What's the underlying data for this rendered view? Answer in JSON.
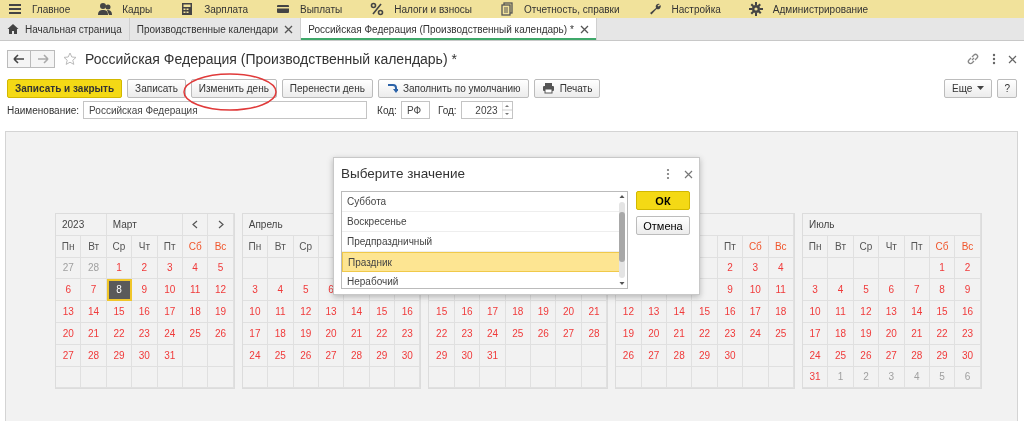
{
  "main_menu": [
    {
      "label": "Главное"
    },
    {
      "label": "Кадры"
    },
    {
      "label": "Зарплата"
    },
    {
      "label": "Выплаты"
    },
    {
      "label": "Налоги и взносы"
    },
    {
      "label": "Отчетность, справки"
    },
    {
      "label": "Настройка"
    },
    {
      "label": "Администрирование"
    }
  ],
  "tabs": [
    {
      "label": "Начальная страница",
      "selected": false,
      "closable": false
    },
    {
      "label": "Производственные календари",
      "selected": false,
      "closable": true
    },
    {
      "label": "Российская Федерация (Производственный календарь) *",
      "selected": true,
      "closable": true
    }
  ],
  "form": {
    "title": "Российская Федерация (Производственный календарь) *"
  },
  "toolbar": [
    {
      "label": "Записать и закрыть",
      "kind": "primary"
    },
    {
      "label": "Записать",
      "kind": "plain"
    },
    {
      "label": "Изменить день",
      "kind": "plain"
    },
    {
      "label": "Перенести день",
      "kind": "plain"
    },
    {
      "label": "Заполнить по умолчанию",
      "kind": "fill"
    },
    {
      "label": "Печать",
      "kind": "print"
    }
  ],
  "toolbar_right": [
    {
      "label": "Еще",
      "kind": "menu"
    },
    {
      "label": "?",
      "kind": "plain"
    }
  ],
  "fields": {
    "name_label": "Наименование:",
    "name_value": "Российская Федерация",
    "code_label": "Код:",
    "code_value": "РФ",
    "year_label": "Год:",
    "year_value": "2023"
  },
  "calendar": {
    "year": "2023",
    "months": [
      {
        "name": "Март",
        "weekdays": [
          {
            "kind": "label",
            "label": "Пн",
            "weekend": false
          },
          {
            "kind": "label",
            "label": "Вт",
            "weekend": false
          },
          {
            "kind": "label",
            "label": "Ср",
            "weekend": false
          },
          {
            "kind": "label",
            "label": "Чт",
            "weekend": false
          },
          {
            "kind": "label",
            "label": "Пт",
            "weekend": false
          },
          {
            "kind": "label",
            "label": "Сб",
            "weekend": true
          },
          {
            "kind": "label",
            "label": "Вс",
            "weekend": true
          }
        ],
        "weeks": [
          [
            {
              "kind": "day",
              "text": "27",
              "other_month": true,
              "selected": false
            },
            {
              "kind": "day",
              "text": "28",
              "other_month": true,
              "selected": false
            },
            {
              "kind": "day",
              "text": "1",
              "other_month": false,
              "selected": false
            },
            {
              "kind": "day",
              "text": "2",
              "other_month": false,
              "selected": false
            },
            {
              "kind": "day",
              "text": "3",
              "other_month": false,
              "selected": false
            },
            {
              "kind": "day",
              "text": "4",
              "other_month": false,
              "selected": false
            },
            {
              "kind": "day",
              "text": "5",
              "other_month": false,
              "selected": false
            }
          ],
          [
            {
              "kind": "day",
              "text": "6",
              "other_month": false,
              "selected": false
            },
            {
              "kind": "day",
              "text": "7",
              "other_month": false,
              "selected": false
            },
            {
              "kind": "day",
              "text": "8",
              "other_month": false,
              "selected": true
            },
            {
              "kind": "day",
              "text": "9",
              "other_month": false,
              "selected": false
            },
            {
              "kind": "day",
              "text": "10",
              "other_month": false,
              "selected": false
            },
            {
              "kind": "day",
              "text": "11",
              "other_month": false,
              "selected": false
            },
            {
              "kind": "day",
              "text": "12",
              "other_month": false,
              "selected": false
            }
          ],
          [
            {
              "kind": "day",
              "text": "13",
              "other_month": false,
              "selected": false
            },
            {
              "kind": "day",
              "text": "14",
              "other_month": false,
              "selected": false
            },
            {
              "kind": "day",
              "text": "15",
              "other_month": false,
              "selected": false
            },
            {
              "kind": "day",
              "text": "16",
              "other_month": false,
              "selected": false
            },
            {
              "kind": "day",
              "text": "17",
              "other_month": false,
              "selected": false
            },
            {
              "kind": "day",
              "text": "18",
              "other_month": false,
              "selected": false
            },
            {
              "kind": "day",
              "text": "19",
              "other_month": false,
              "selected": false
            }
          ],
          [
            {
              "kind": "day",
              "text": "20",
              "other_month": false,
              "selected": false
            },
            {
              "kind": "day",
              "text": "21",
              "other_month": false,
              "selected": false
            },
            {
              "kind": "day",
              "text": "22",
              "other_month": false,
              "selected": false
            },
            {
              "kind": "day",
              "text": "23",
              "other_month": false,
              "selected": false
            },
            {
              "kind": "day",
              "text": "24",
              "other_month": false,
              "selected": false
            },
            {
              "kind": "day",
              "text": "25",
              "other_month": false,
              "selected": false
            },
            {
              "kind": "day",
              "text": "26",
              "other_month": false,
              "selected": false
            }
          ],
          [
            {
              "kind": "day",
              "text": "27",
              "other_month": false,
              "selected": false
            },
            {
              "kind": "day",
              "text": "28",
              "other_month": false,
              "selected": false
            },
            {
              "kind": "day",
              "text": "29",
              "other_month": false,
              "selected": false
            },
            {
              "kind": "day",
              "text": "30",
              "other_month": false,
              "selected": false
            },
            {
              "kind": "day",
              "text": "31",
              "other_month": false,
              "selected": false
            },
            {
              "kind": "blank"
            },
            {
              "kind": "blank"
            }
          ],
          [
            {
              "kind": "blank"
            },
            {
              "kind": "blank"
            },
            {
              "kind": "blank"
            },
            {
              "kind": "blank"
            },
            {
              "kind": "blank"
            },
            {
              "kind": "blank"
            },
            {
              "kind": "blank"
            }
          ]
        ]
      },
      {
        "name": "Апрель",
        "weekdays": [
          {
            "kind": "label",
            "label": "Пн",
            "weekend": false
          },
          {
            "kind": "label",
            "label": "Вт",
            "weekend": false
          },
          {
            "kind": "label",
            "label": "Ср",
            "weekend": false
          },
          {
            "kind": "blank"
          },
          {
            "kind": "blank"
          },
          {
            "kind": "blank"
          },
          {
            "kind": "blank"
          }
        ],
        "weeks": [
          [
            {
              "kind": "blank"
            },
            {
              "kind": "blank"
            },
            {
              "kind": "blank"
            },
            {
              "kind": "blank"
            },
            {
              "kind": "blank"
            },
            {
              "kind": "blank"
            },
            {
              "kind": "blank"
            }
          ],
          [
            {
              "kind": "day",
              "text": "3",
              "other_month": false,
              "selected": false
            },
            {
              "kind": "day",
              "text": "4",
              "other_month": false,
              "selected": false
            },
            {
              "kind": "day",
              "text": "5",
              "other_month": false,
              "selected": false
            },
            {
              "kind": "day",
              "text": "6",
              "other_month": false,
              "selected": false
            },
            {
              "kind": "blank"
            },
            {
              "kind": "blank"
            },
            {
              "kind": "blank"
            }
          ],
          [
            {
              "kind": "day",
              "text": "10",
              "other_month": false,
              "selected": false
            },
            {
              "kind": "day",
              "text": "11",
              "other_month": false,
              "selected": false
            },
            {
              "kind": "day",
              "text": "12",
              "other_month": false,
              "selected": false
            },
            {
              "kind": "day",
              "text": "13",
              "other_month": false,
              "selected": false
            },
            {
              "kind": "day",
              "text": "14",
              "other_month": false,
              "selected": false
            },
            {
              "kind": "day",
              "text": "15",
              "other_month": false,
              "selected": false
            },
            {
              "kind": "day",
              "text": "16",
              "other_month": false,
              "selected": false
            }
          ],
          [
            {
              "kind": "day",
              "text": "17",
              "other_month": false,
              "selected": false
            },
            {
              "kind": "day",
              "text": "18",
              "other_month": false,
              "selected": false
            },
            {
              "kind": "day",
              "text": "19",
              "other_month": false,
              "selected": false
            },
            {
              "kind": "day",
              "text": "20",
              "other_month": false,
              "selected": false
            },
            {
              "kind": "day",
              "text": "21",
              "other_month": false,
              "selected": false
            },
            {
              "kind": "day",
              "text": "22",
              "other_month": false,
              "selected": false
            },
            {
              "kind": "day",
              "text": "23",
              "other_month": false,
              "selected": false
            }
          ],
          [
            {
              "kind": "day",
              "text": "24",
              "other_month": false,
              "selected": false
            },
            {
              "kind": "day",
              "text": "25",
              "other_month": false,
              "selected": false
            },
            {
              "kind": "day",
              "text": "26",
              "other_month": false,
              "selected": false
            },
            {
              "kind": "day",
              "text": "27",
              "other_month": false,
              "selected": false
            },
            {
              "kind": "day",
              "text": "28",
              "other_month": false,
              "selected": false
            },
            {
              "kind": "day",
              "text": "29",
              "other_month": false,
              "selected": false
            },
            {
              "kind": "day",
              "text": "30",
              "other_month": false,
              "selected": false
            }
          ],
          [
            {
              "kind": "blank"
            },
            {
              "kind": "blank"
            },
            {
              "kind": "blank"
            },
            {
              "kind": "blank"
            },
            {
              "kind": "blank"
            },
            {
              "kind": "blank"
            },
            {
              "kind": "blank"
            }
          ]
        ]
      },
      {
        "weekdays": [
          {
            "kind": "blank"
          },
          {
            "kind": "blank"
          },
          {
            "kind": "blank"
          },
          {
            "kind": "blank"
          },
          {
            "kind": "blank"
          },
          {
            "kind": "blank"
          },
          {
            "kind": "blank"
          }
        ],
        "weeks": [
          [
            {
              "kind": "blank"
            },
            {
              "kind": "blank"
            },
            {
              "kind": "blank"
            },
            {
              "kind": "blank"
            },
            {
              "kind": "blank"
            },
            {
              "kind": "blank"
            },
            {
              "kind": "blank"
            }
          ],
          [
            {
              "kind": "blank"
            },
            {
              "kind": "blank"
            },
            {
              "kind": "blank"
            },
            {
              "kind": "blank"
            },
            {
              "kind": "blank"
            },
            {
              "kind": "blank"
            },
            {
              "kind": "blank"
            }
          ],
          [
            {
              "kind": "day",
              "text": "15",
              "other_month": false,
              "selected": false
            },
            {
              "kind": "day",
              "text": "16",
              "other_month": false,
              "selected": false
            },
            {
              "kind": "day",
              "text": "17",
              "other_month": false,
              "selected": false
            },
            {
              "kind": "day",
              "text": "18",
              "other_month": false,
              "selected": false
            },
            {
              "kind": "day",
              "text": "19",
              "other_month": false,
              "selected": false
            },
            {
              "kind": "day",
              "text": "20",
              "other_month": false,
              "selected": false
            },
            {
              "kind": "day",
              "text": "21",
              "other_month": false,
              "selected": false
            }
          ],
          [
            {
              "kind": "day",
              "text": "22",
              "other_month": false,
              "selected": false
            },
            {
              "kind": "day",
              "text": "23",
              "other_month": false,
              "selected": false
            },
            {
              "kind": "day",
              "text": "24",
              "other_month": false,
              "selected": false
            },
            {
              "kind": "day",
              "text": "25",
              "other_month": false,
              "selected": false
            },
            {
              "kind": "day",
              "text": "26",
              "other_month": false,
              "selected": false
            },
            {
              "kind": "day",
              "text": "27",
              "other_month": false,
              "selected": false
            },
            {
              "kind": "day",
              "text": "28",
              "other_month": false,
              "selected": false
            }
          ],
          [
            {
              "kind": "day",
              "text": "29",
              "other_month": false,
              "selected": false
            },
            {
              "kind": "day",
              "text": "30",
              "other_month": false,
              "selected": false
            },
            {
              "kind": "day",
              "text": "31",
              "other_month": false,
              "selected": false
            },
            {
              "kind": "blank"
            },
            {
              "kind": "blank"
            },
            {
              "kind": "blank"
            },
            {
              "kind": "blank"
            }
          ],
          [
            {
              "kind": "blank"
            },
            {
              "kind": "blank"
            },
            {
              "kind": "blank"
            },
            {
              "kind": "blank"
            },
            {
              "kind": "blank"
            },
            {
              "kind": "blank"
            },
            {
              "kind": "blank"
            }
          ]
        ]
      },
      {
        "weekdays": [
          {
            "kind": "blank"
          },
          {
            "kind": "blank"
          },
          {
            "kind": "blank"
          },
          {
            "kind": "blank"
          },
          {
            "kind": "label",
            "label": "Пт",
            "weekend": false
          },
          {
            "kind": "label",
            "label": "Сб",
            "weekend": true
          },
          {
            "kind": "label",
            "label": "Вс",
            "weekend": true
          }
        ],
        "weeks": [
          [
            {
              "kind": "blank"
            },
            {
              "kind": "blank"
            },
            {
              "kind": "blank"
            },
            {
              "kind": "blank"
            },
            {
              "kind": "day",
              "text": "2",
              "other_month": false,
              "selected": false
            },
            {
              "kind": "day",
              "text": "3",
              "other_month": false,
              "selected": false
            },
            {
              "kind": "day",
              "text": "4",
              "other_month": false,
              "selected": false
            }
          ],
          [
            {
              "kind": "blank"
            },
            {
              "kind": "blank"
            },
            {
              "kind": "blank"
            },
            {
              "kind": "blank"
            },
            {
              "kind": "day",
              "text": "9",
              "other_month": false,
              "selected": false
            },
            {
              "kind": "day",
              "text": "10",
              "other_month": false,
              "selected": false
            },
            {
              "kind": "day",
              "text": "11",
              "other_month": false,
              "selected": false
            }
          ],
          [
            {
              "kind": "day",
              "text": "12",
              "other_month": false,
              "selected": false
            },
            {
              "kind": "day",
              "text": "13",
              "other_month": false,
              "selected": false
            },
            {
              "kind": "day",
              "text": "14",
              "other_month": false,
              "selected": false
            },
            {
              "kind": "day",
              "text": "15",
              "other_month": false,
              "selected": false
            },
            {
              "kind": "day",
              "text": "16",
              "other_month": false,
              "selected": false
            },
            {
              "kind": "day",
              "text": "17",
              "other_month": false,
              "selected": false
            },
            {
              "kind": "day",
              "text": "18",
              "other_month": false,
              "selected": false
            }
          ],
          [
            {
              "kind": "day",
              "text": "19",
              "other_month": false,
              "selected": false
            },
            {
              "kind": "day",
              "text": "20",
              "other_month": false,
              "selected": false
            },
            {
              "kind": "day",
              "text": "21",
              "other_month": false,
              "selected": false
            },
            {
              "kind": "day",
              "text": "22",
              "other_month": false,
              "selected": false
            },
            {
              "kind": "day",
              "text": "23",
              "other_month": false,
              "selected": false
            },
            {
              "kind": "day",
              "text": "24",
              "other_month": false,
              "selected": false
            },
            {
              "kind": "day",
              "text": "25",
              "other_month": false,
              "selected": false
            }
          ],
          [
            {
              "kind": "day",
              "text": "26",
              "other_month": false,
              "selected": false
            },
            {
              "kind": "day",
              "text": "27",
              "other_month": false,
              "selected": false
            },
            {
              "kind": "day",
              "text": "28",
              "other_month": false,
              "selected": false
            },
            {
              "kind": "day",
              "text": "29",
              "other_month": false,
              "selected": false
            },
            {
              "kind": "day",
              "text": "30",
              "other_month": false,
              "selected": false
            },
            {
              "kind": "blank"
            },
            {
              "kind": "blank"
            }
          ],
          [
            {
              "kind": "blank"
            },
            {
              "kind": "blank"
            },
            {
              "kind": "blank"
            },
            {
              "kind": "blank"
            },
            {
              "kind": "blank"
            },
            {
              "kind": "blank"
            },
            {
              "kind": "blank"
            }
          ]
        ]
      },
      {
        "name": "Июль",
        "weekdays": [
          {
            "kind": "label",
            "label": "Пн",
            "weekend": false
          },
          {
            "kind": "label",
            "label": "Вт",
            "weekend": false
          },
          {
            "kind": "label",
            "label": "Ср",
            "weekend": false
          },
          {
            "kind": "label",
            "label": "Чт",
            "weekend": false
          },
          {
            "kind": "label",
            "label": "Пт",
            "weekend": false
          },
          {
            "kind": "label",
            "label": "Сб",
            "weekend": true
          },
          {
            "kind": "label",
            "label": "Вс",
            "weekend": true
          }
        ],
        "weeks": [
          [
            {
              "kind": "blank"
            },
            {
              "kind": "blank"
            },
            {
              "kind": "blank"
            },
            {
              "kind": "blank"
            },
            {
              "kind": "blank"
            },
            {
              "kind": "day",
              "text": "1",
              "other_month": false,
              "selected": false
            },
            {
              "kind": "day",
              "text": "2",
              "other_month": false,
              "selected": false
            }
          ],
          [
            {
              "kind": "day",
              "text": "3",
              "other_month": false,
              "selected": false
            },
            {
              "kind": "day",
              "text": "4",
              "other_month": false,
              "selected": false
            },
            {
              "kind": "day",
              "text": "5",
              "other_month": false,
              "selected": false
            },
            {
              "kind": "day",
              "text": "6",
              "other_month": false,
              "selected": false
            },
            {
              "kind": "day",
              "text": "7",
              "other_month": false,
              "selected": false
            },
            {
              "kind": "day",
              "text": "8",
              "other_month": false,
              "selected": false
            },
            {
              "kind": "day",
              "text": "9",
              "other_month": false,
              "selected": false
            }
          ],
          [
            {
              "kind": "day",
              "text": "10",
              "other_month": false,
              "selected": false
            },
            {
              "kind": "day",
              "text": "11",
              "other_month": false,
              "selected": false
            },
            {
              "kind": "day",
              "text": "12",
              "other_month": false,
              "selected": false
            },
            {
              "kind": "day",
              "text": "13",
              "other_month": false,
              "selected": false
            },
            {
              "kind": "day",
              "text": "14",
              "other_month": false,
              "selected": false
            },
            {
              "kind": "day",
              "text": "15",
              "other_month": false,
              "selected": false
            },
            {
              "kind": "day",
              "text": "16",
              "other_month": false,
              "selected": false
            }
          ],
          [
            {
              "kind": "day",
              "text": "17",
              "other_month": false,
              "selected": false
            },
            {
              "kind": "day",
              "text": "18",
              "other_month": false,
              "selected": false
            },
            {
              "kind": "day",
              "text": "19",
              "other_month": false,
              "selected": false
            },
            {
              "kind": "day",
              "text": "20",
              "other_month": false,
              "selected": false
            },
            {
              "kind": "day",
              "text": "21",
              "other_month": false,
              "selected": false
            },
            {
              "kind": "day",
              "text": "22",
              "other_month": false,
              "selected": false
            },
            {
              "kind": "day",
              "text": "23",
              "other_month": false,
              "selected": false
            }
          ],
          [
            {
              "kind": "day",
              "text": "24",
              "other_month": false,
              "selected": false
            },
            {
              "kind": "day",
              "text": "25",
              "other_month": false,
              "selected": false
            },
            {
              "kind": "day",
              "text": "26",
              "other_month": false,
              "selected": false
            },
            {
              "kind": "day",
              "text": "27",
              "other_month": false,
              "selected": false
            },
            {
              "kind": "day",
              "text": "28",
              "other_month": false,
              "selected": false
            },
            {
              "kind": "day",
              "text": "29",
              "other_month": false,
              "selected": false
            },
            {
              "kind": "day",
              "text": "30",
              "other_month": false,
              "selected": false
            }
          ],
          [
            {
              "kind": "day",
              "text": "31",
              "other_month": false,
              "selected": false
            },
            {
              "kind": "day",
              "text": "1",
              "other_month": true,
              "selected": false
            },
            {
              "kind": "day",
              "text": "2",
              "other_month": true,
              "selected": false
            },
            {
              "kind": "day",
              "text": "3",
              "other_month": true,
              "selected": false
            },
            {
              "kind": "day",
              "text": "4",
              "other_month": true,
              "selected": false
            },
            {
              "kind": "day",
              "text": "5",
              "other_month": true,
              "selected": false
            },
            {
              "kind": "day",
              "text": "6",
              "other_month": true,
              "selected": false
            }
          ]
        ]
      }
    ]
  },
  "dialog": {
    "title": "Выберите значение",
    "items": [
      {
        "label": "Суббота",
        "selected": false
      },
      {
        "label": "Воскресенье",
        "selected": false
      },
      {
        "label": "Предпраздничный",
        "selected": false
      },
      {
        "label": "Праздник",
        "selected": true
      },
      {
        "label": "Нерабочий",
        "selected": false
      }
    ],
    "ok": "ОК",
    "cancel": "Отмена"
  }
}
